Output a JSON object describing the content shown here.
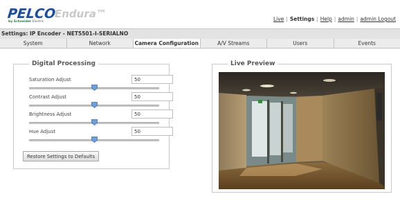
{
  "brand": {
    "logo_text": "PELCO",
    "logo_sub_brand": "by Schneider",
    "logo_sub_tail": "Electric",
    "product": "Endura™"
  },
  "top_links": {
    "live": "Live",
    "settings": "Settings",
    "help": "Help",
    "admin": "admin",
    "logout": "admin Logout"
  },
  "title": "Settings: IP Encoder - NET5501-I-SERIALNO",
  "tabs": [
    "System",
    "Network",
    "Camera Configuration",
    "A/V Streams",
    "Users",
    "Events"
  ],
  "active_tab": "Camera Configuration",
  "digital_processing": {
    "legend": "Digital Processing",
    "adjustments": [
      {
        "label": "Saturation Adjust",
        "value": "50",
        "level": 0.5
      },
      {
        "label": "Contrast Adjust",
        "value": "50",
        "level": 0.5
      },
      {
        "label": "Brightness Adjust",
        "value": "50",
        "level": 0.5
      },
      {
        "label": "Hue Adjust",
        "value": "50",
        "level": 0.5
      }
    ],
    "restore_label": "Restore Settings to Defaults"
  },
  "live_preview": {
    "legend": "Live Preview"
  },
  "colors": {
    "brand_blue": "#1d4f9c",
    "slider_thumb": "#6f9fd8",
    "active_tab_bg": "#ffffff",
    "tab_bg": "#ececec"
  }
}
